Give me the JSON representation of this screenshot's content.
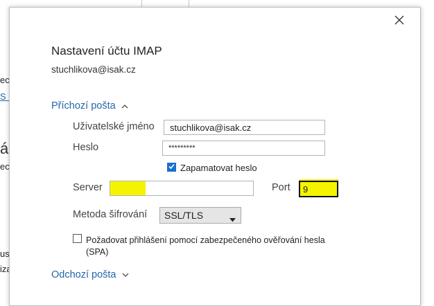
{
  "background": {
    "fragments": [
      "ect",
      "S n",
      "án",
      "ech",
      "usp",
      "iza"
    ]
  },
  "dialog": {
    "title": "Nastavení účtu IMAP",
    "account_email": "stuchlikova@isak.cz",
    "incoming": {
      "header": "Příchozí pošta",
      "username_label": "Uživatelské jméno",
      "username_value": "stuchlikova@isak.cz",
      "password_label": "Heslo",
      "password_value": "*********",
      "remember_label": "Zapamatovat heslo",
      "remember_checked": true,
      "server_label": "Server",
      "server_value": "",
      "port_label": "Port",
      "port_value": "9",
      "encryption_label": "Metoda šifrování",
      "encryption_value": "SSL/TLS",
      "spa_label_line1": "Požadovat přihlášení pomocí zabezpečeného ověřování hesla",
      "spa_label_line2": "(SPA)",
      "spa_checked": false
    },
    "outgoing": {
      "header": "Odchozí pošta"
    }
  },
  "colors": {
    "link": "#2566a8",
    "accent": "#1a6fd0",
    "highlight": "#f4f400"
  },
  "icons": {
    "close": "close-icon",
    "incoming_toggle": "chevron-up-icon",
    "outgoing_toggle": "chevron-down-icon",
    "select_arrow": "caret-down-icon"
  }
}
